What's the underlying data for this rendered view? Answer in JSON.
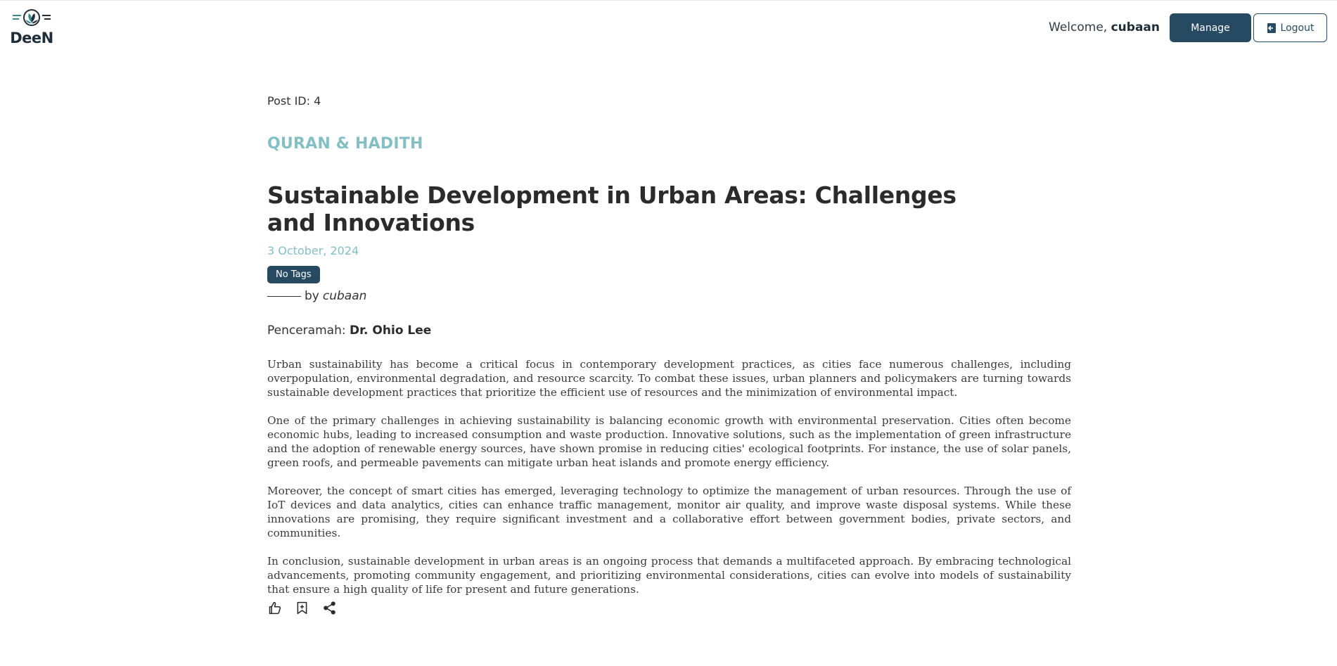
{
  "header": {
    "logo_text": "DeeN",
    "welcome_prefix": "Welcome, ",
    "username": "cubaan",
    "manage_label": "Manage",
    "logout_label": "Logout",
    "logout_icon": "logout-icon"
  },
  "post": {
    "id_label": "Post ID: 4",
    "category": "QURAN & HADITH",
    "title": "Sustainable Development in Urban Areas: Challenges and Innovations",
    "date": "3 October, 2024",
    "tag": "No Tags",
    "by_label": "by",
    "author": "cubaan",
    "speaker_label": "Penceramah:",
    "speaker_name": "Dr. Ohio Lee",
    "paragraphs": [
      "Urban sustainability has become a critical focus in contemporary development practices, as cities face numerous challenges, including overpopulation, environmental degradation, and resource scarcity. To combat these issues, urban planners and policymakers are turning towards sustainable development practices that prioritize the efficient use of resources and the minimization of environmental impact.",
      "One of the primary challenges in achieving sustainability is balancing economic growth with environmental preservation. Cities often become economic hubs, leading to increased consumption and waste production. Innovative solutions, such as the implementation of green infrastructure and the adoption of renewable energy sources, have shown promise in reducing cities' ecological footprints. For instance, the use of solar panels, green roofs, and permeable pavements can mitigate urban heat islands and promote energy efficiency.",
      "Moreover, the concept of smart cities has emerged, leveraging technology to optimize the management of urban resources. Through the use of IoT devices and data analytics, cities can enhance traffic management, monitor air quality, and improve waste disposal systems. While these innovations are promising, they require significant investment and a collaborative effort between government bodies, private sectors, and communities.",
      "In conclusion, sustainable development in urban areas is an ongoing process that demands a multifaceted approach. By embracing technological advancements, promoting community engagement, and prioritizing environmental considerations, cities can evolve into models of sustainability that ensure a high quality of life for present and future generations."
    ],
    "actions": [
      "thumbs-up-icon",
      "bookmark-add-icon",
      "share-icon"
    ]
  },
  "colors": {
    "accent": "#84bfc4",
    "primary": "#274a63"
  }
}
